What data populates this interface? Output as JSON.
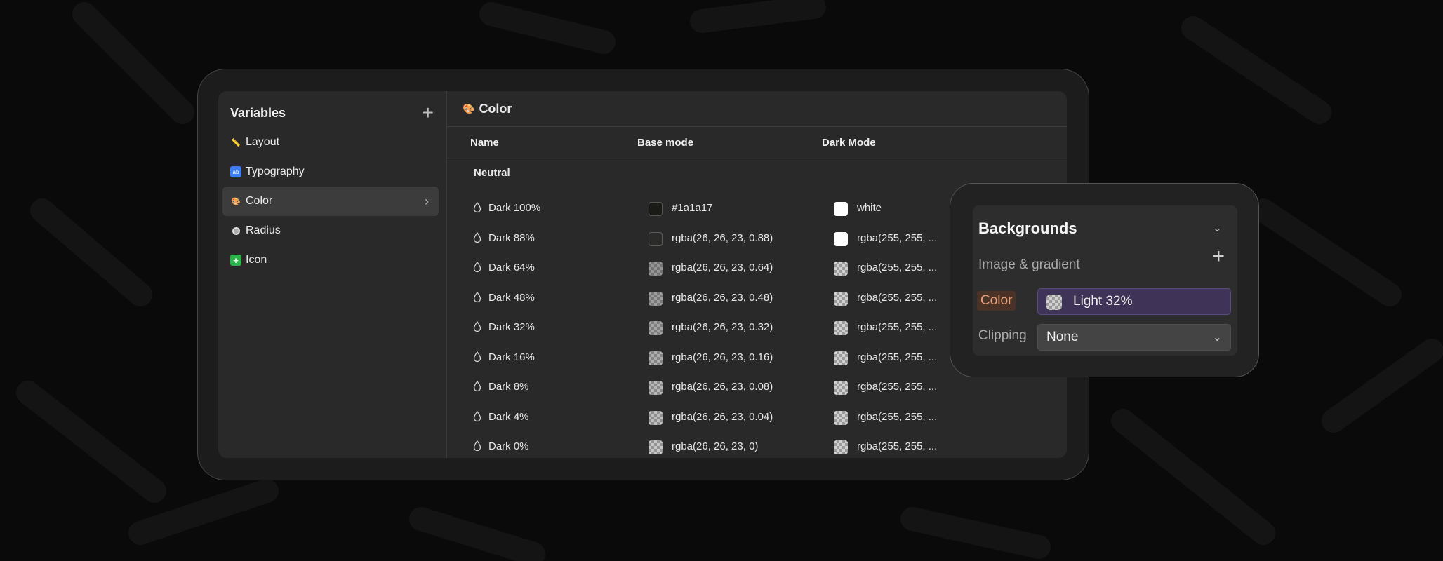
{
  "sidebar": {
    "title": "Variables",
    "add_icon": "plus-icon",
    "items": [
      {
        "label": "Layout",
        "icon": "ruler-icon"
      },
      {
        "label": "Typography",
        "icon": "abcd-icon"
      },
      {
        "label": "Color",
        "icon": "palette-icon",
        "active": true
      },
      {
        "label": "Radius",
        "icon": "circle-icon"
      },
      {
        "label": "Icon",
        "icon": "plus-square-icon"
      }
    ]
  },
  "main": {
    "title": "Color",
    "title_icon": "palette-icon",
    "columns": [
      "Name",
      "Base mode",
      "Dark Mode"
    ],
    "group_label": "Neutral",
    "rows": [
      {
        "name": "Dark 100%",
        "base": "#1a1a17",
        "dark": "white"
      },
      {
        "name": "Dark 88%",
        "base": "rgba(26, 26, 23, 0.88)",
        "dark": "rgba(255, 255, ..."
      },
      {
        "name": "Dark 64%",
        "base": "rgba(26, 26, 23, 0.64)",
        "dark": "rgba(255, 255, ..."
      },
      {
        "name": "Dark 48%",
        "base": "rgba(26, 26, 23, 0.48)",
        "dark": "rgba(255, 255, ..."
      },
      {
        "name": "Dark 32%",
        "base": "rgba(26, 26, 23, 0.32)",
        "dark": "rgba(255, 255, ..."
      },
      {
        "name": "Dark 16%",
        "base": "rgba(26, 26, 23, 0.16)",
        "dark": "rgba(255, 255, ..."
      },
      {
        "name": "Dark 8%",
        "base": "rgba(26, 26, 23, 0.08)",
        "dark": "rgba(255, 255, ..."
      },
      {
        "name": "Dark 4%",
        "base": "rgba(26, 26, 23, 0.04)",
        "dark": "rgba(255, 255, ..."
      },
      {
        "name": "Dark 0%",
        "base": "rgba(26, 26, 23, 0)",
        "dark": "rgba(255, 255, ..."
      }
    ]
  },
  "backgrounds_panel": {
    "title": "Backgrounds",
    "image_gradient_label": "Image & gradient",
    "color_label": "Color",
    "color_value": "Light 32%",
    "clipping_label": "Clipping",
    "clipping_value": "None"
  },
  "colors": {
    "page_bg": "#0a0a0a",
    "panel_bg": "#292929",
    "accent_field": "#3f3457",
    "color_tag_text": "#e8a27e"
  }
}
